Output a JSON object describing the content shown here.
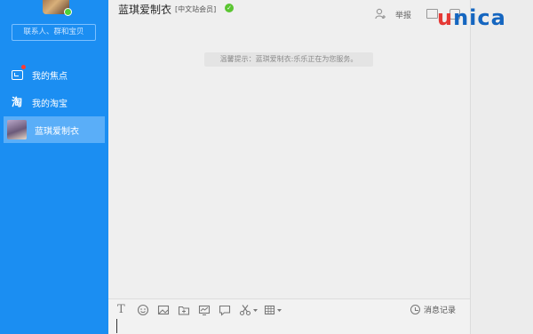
{
  "sidebar": {
    "search_placeholder": "联系人、群和宝贝",
    "items": [
      {
        "label": "我的焦点",
        "icon": "focus-icon"
      },
      {
        "label": "我的淘宝",
        "icon": "taobao-icon"
      },
      {
        "label": "蓝琪爱制衣",
        "icon": "shop-avatar"
      }
    ]
  },
  "header": {
    "title": "蓝琪爱制衣",
    "member_badge": "[中文站会员]",
    "report_label": "举报"
  },
  "chat": {
    "notice": "温馨提示：蓝琪爱制衣:乐乐正在为您服务。"
  },
  "input_toolbar": {
    "history_label": "消息记录",
    "tools": [
      "text-format-icon",
      "emoji-icon",
      "image-icon",
      "folder-icon",
      "screen-icon",
      "comment-icon",
      "scissors-icon",
      "grid-icon"
    ]
  },
  "watermark": {
    "u": "u",
    "rest": "nica"
  },
  "colors": {
    "sidebar": "#1b8ef2",
    "sidebar_active": "#5aaef8",
    "verified": "#5ac531",
    "logo_red": "#e53935",
    "logo_blue": "#1566c0"
  }
}
